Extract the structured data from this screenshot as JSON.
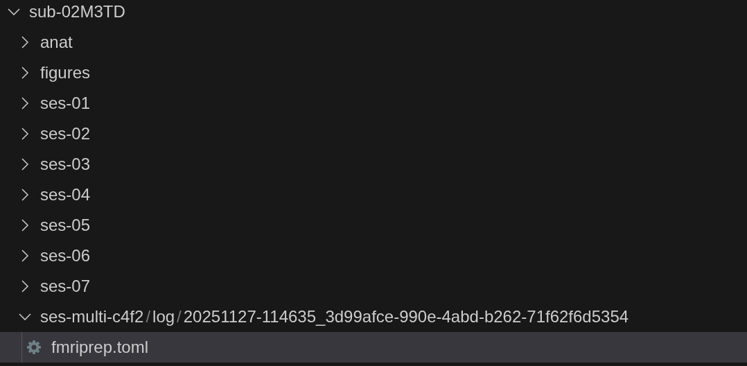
{
  "tree": {
    "kind": "folder",
    "label": "sub-02M3TD",
    "expanded": true,
    "selected": false,
    "children": [
      {
        "kind": "folder",
        "label": "anat",
        "expanded": false,
        "selected": false
      },
      {
        "kind": "folder",
        "label": "figures",
        "expanded": false,
        "selected": false
      },
      {
        "kind": "folder",
        "label": "ses-01",
        "expanded": false,
        "selected": false
      },
      {
        "kind": "folder",
        "label": "ses-02",
        "expanded": false,
        "selected": false
      },
      {
        "kind": "folder",
        "label": "ses-03",
        "expanded": false,
        "selected": false
      },
      {
        "kind": "folder",
        "label": "ses-04",
        "expanded": false,
        "selected": false
      },
      {
        "kind": "folder",
        "label": "ses-05",
        "expanded": false,
        "selected": false
      },
      {
        "kind": "folder",
        "label": "ses-06",
        "expanded": false,
        "selected": false
      },
      {
        "kind": "folder",
        "label": "ses-07",
        "expanded": false,
        "selected": false
      },
      {
        "kind": "compact-folder",
        "segments": [
          "ses-multi-c4f2",
          "log",
          "20251127-114635_3d99afce-990e-4abd-b262-71f62f6d5354"
        ],
        "separator": "/",
        "expanded": true,
        "selected": false,
        "children": [
          {
            "kind": "file",
            "label": "fmriprep.toml",
            "selected": true
          }
        ]
      }
    ]
  }
}
